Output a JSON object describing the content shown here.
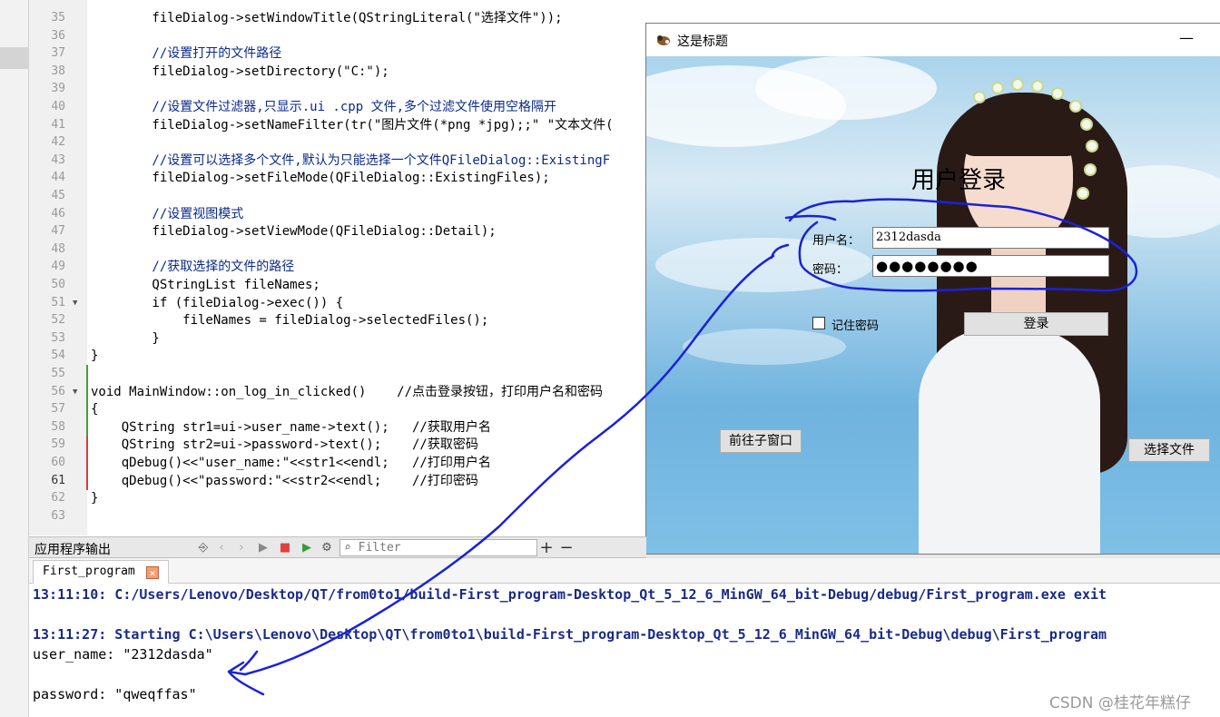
{
  "editor": {
    "lines": [
      {
        "n": "35",
        "code": "        fileDialog->setWindowTitle(QStringLiteral(\"选择文件\"));",
        "type": "plain"
      },
      {
        "n": "36",
        "code": "",
        "type": "plain"
      },
      {
        "n": "37",
        "code": "        //设置打开的文件路径",
        "type": "comment"
      },
      {
        "n": "38",
        "code": "        fileDialog->setDirectory(\"C:\");",
        "type": "plain"
      },
      {
        "n": "39",
        "code": "",
        "type": "plain"
      },
      {
        "n": "40",
        "code": "        //设置文件过滤器,只显示.ui .cpp 文件,多个过滤文件使用空格隔开",
        "type": "comment"
      },
      {
        "n": "41",
        "code": "        fileDialog->setNameFilter(tr(\"图片文件(*png *jpg);;\" \"文本文件(",
        "type": "plain"
      },
      {
        "n": "42",
        "code": "",
        "type": "plain"
      },
      {
        "n": "43",
        "code": "        //设置可以选择多个文件,默认为只能选择一个文件QFileDialog::ExistingF",
        "type": "comment"
      },
      {
        "n": "44",
        "code": "        fileDialog->setFileMode(QFileDialog::ExistingFiles);",
        "type": "plain"
      },
      {
        "n": "45",
        "code": "",
        "type": "plain"
      },
      {
        "n": "46",
        "code": "        //设置视图模式",
        "type": "comment"
      },
      {
        "n": "47",
        "code": "        fileDialog->setViewMode(QFileDialog::Detail);",
        "type": "plain"
      },
      {
        "n": "48",
        "code": "",
        "type": "plain"
      },
      {
        "n": "49",
        "code": "        //获取选择的文件的路径",
        "type": "comment"
      },
      {
        "n": "50",
        "code": "        QStringList fileNames;",
        "type": "plain"
      },
      {
        "n": "51",
        "code": "        if (fileDialog->exec()) {",
        "type": "plain"
      },
      {
        "n": "52",
        "code": "            fileNames = fileDialog->selectedFiles();",
        "type": "plain"
      },
      {
        "n": "53",
        "code": "        }",
        "type": "plain"
      },
      {
        "n": "54",
        "code": "}",
        "type": "plain"
      },
      {
        "n": "55",
        "code": "",
        "type": "plain"
      },
      {
        "n": "56",
        "code": "void MainWindow::on_log_in_clicked()    //点击登录按钮，打印用户名和密码",
        "type": "plain"
      },
      {
        "n": "57",
        "code": "{",
        "type": "plain"
      },
      {
        "n": "58",
        "code": "    QString str1=ui->user_name->text();   //获取用户名",
        "type": "plain"
      },
      {
        "n": "59",
        "code": "    QString str2=ui->password->text();    //获取密码",
        "type": "plain"
      },
      {
        "n": "60",
        "code": "    qDebug()<<\"user_name:\"<<str1<<endl;   //打印用户名",
        "type": "plain"
      },
      {
        "n": "61",
        "code": "    qDebug()<<\"password:\"<<str2<<endl;    //打印密码",
        "type": "plain"
      },
      {
        "n": "62",
        "code": "}",
        "type": "plain"
      },
      {
        "n": "63",
        "code": "",
        "type": "plain"
      }
    ]
  },
  "qt_window": {
    "title": "这是标题",
    "minimize": "—",
    "login_title": "用户登录",
    "username_label": "用户名：",
    "username_value": "2312dasda",
    "password_label": "密码：",
    "password_value": "●●●●●●●●",
    "remember_label": "记住密码",
    "login_button": "登录",
    "child_window_button": "前往子窗口",
    "select_file_button": "选择文件"
  },
  "output_pane": {
    "title": "应用程序输出",
    "filter_placeholder": "Filter",
    "plus": "+",
    "minus": "−",
    "tab_label": "First_program",
    "tab_close": "×",
    "lines": [
      {
        "text": "13:11:10: C:/Users/Lenovo/Desktop/QT/from0to1/build-First_program-Desktop_Qt_5_12_6_MinGW_64_bit-Debug/debug/First_program.exe exit",
        "style": "info"
      },
      {
        "text": "",
        "style": "norm"
      },
      {
        "text": "13:11:27: Starting C:\\Users\\Lenovo\\Desktop\\QT\\from0to1\\build-First_program-Desktop_Qt_5_12_6_MinGW_64_bit-Debug\\debug\\First_program",
        "style": "info"
      },
      {
        "text": "user_name: \"2312dasda\"",
        "style": "norm"
      },
      {
        "text": "",
        "style": "norm"
      },
      {
        "text": "password: \"qweqffas\"",
        "style": "norm"
      }
    ]
  },
  "watermark": "CSDN @桂花年糕仔"
}
